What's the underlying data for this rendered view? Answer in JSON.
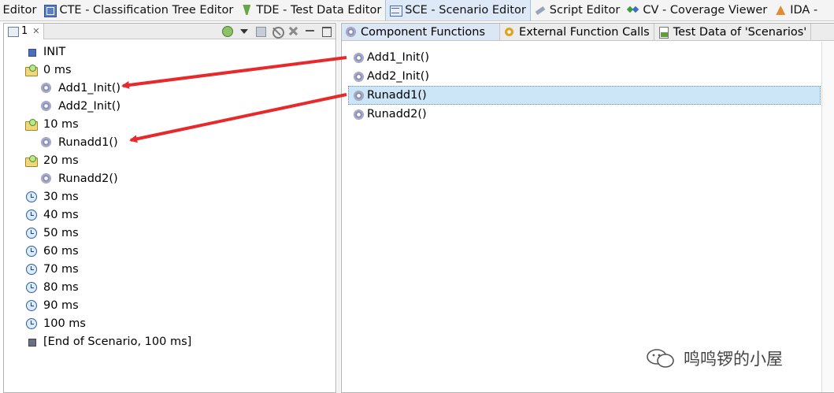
{
  "perspective_tabs": [
    {
      "label": "e Editor",
      "icon": "none"
    },
    {
      "label": "CTE - Classification Tree Editor",
      "icon": "tree-icon"
    },
    {
      "label": "TDE - Test Data Editor",
      "icon": "tde-icon"
    },
    {
      "label": "SCE - Scenario Editor",
      "icon": "sce-icon",
      "active": true
    },
    {
      "label": "Script Editor",
      "icon": "script-icon"
    },
    {
      "label": "CV - Coverage Viewer",
      "icon": "cv-icon"
    },
    {
      "label": "IDA -",
      "icon": "ida-icon"
    }
  ],
  "left_view": {
    "tab_label": "1",
    "tab_close": "✕",
    "tree": [
      {
        "label": "INIT",
        "icon": "init-square-icon",
        "level": 1
      },
      {
        "label": "0 ms",
        "icon": "time-folder-icon",
        "level": 1
      },
      {
        "label": "Add1_Init()",
        "icon": "gear-icon",
        "level": 2
      },
      {
        "label": "Add2_Init()",
        "icon": "gear-icon",
        "level": 2
      },
      {
        "label": "10 ms",
        "icon": "time-folder-icon",
        "level": 1
      },
      {
        "label": "Runadd1()",
        "icon": "gear-icon",
        "level": 2
      },
      {
        "label": "20 ms",
        "icon": "time-folder-icon",
        "level": 1
      },
      {
        "label": "Runadd2()",
        "icon": "gear-icon",
        "level": 2
      },
      {
        "label": "30 ms",
        "icon": "clock-icon",
        "level": 1
      },
      {
        "label": "40 ms",
        "icon": "clock-icon",
        "level": 1
      },
      {
        "label": "50 ms",
        "icon": "clock-icon",
        "level": 1
      },
      {
        "label": "60 ms",
        "icon": "clock-icon",
        "level": 1
      },
      {
        "label": "70 ms",
        "icon": "clock-icon",
        "level": 1
      },
      {
        "label": "80 ms",
        "icon": "clock-icon",
        "level": 1
      },
      {
        "label": "90 ms",
        "icon": "clock-icon",
        "level": 1
      },
      {
        "label": "100 ms",
        "icon": "clock-icon",
        "level": 1
      },
      {
        "label": "[End of Scenario, 100 ms]",
        "icon": "end-square-icon",
        "level": 1
      }
    ]
  },
  "right_view": {
    "tabs": [
      {
        "label": "Component Functions",
        "icon": "gear-icon",
        "active": true
      },
      {
        "label": "External Function Calls",
        "icon": "external-icon"
      },
      {
        "label": "Test Data of 'Scenarios'",
        "icon": "testdata-icon"
      }
    ],
    "functions": [
      {
        "label": "Add1_Init()",
        "selected": false
      },
      {
        "label": "Add2_Init()",
        "selected": false
      },
      {
        "label": "Runadd1()",
        "selected": true
      },
      {
        "label": "Runadd2()",
        "selected": false
      }
    ]
  },
  "annotation": {
    "arrow_color": "#e8292b"
  },
  "watermark": {
    "text": "鸣鸣锣的小屋",
    "icon": "chat-bubble-icon"
  },
  "colors": {
    "selection": "#cde6f7",
    "active_tab": "#dde9f6"
  }
}
